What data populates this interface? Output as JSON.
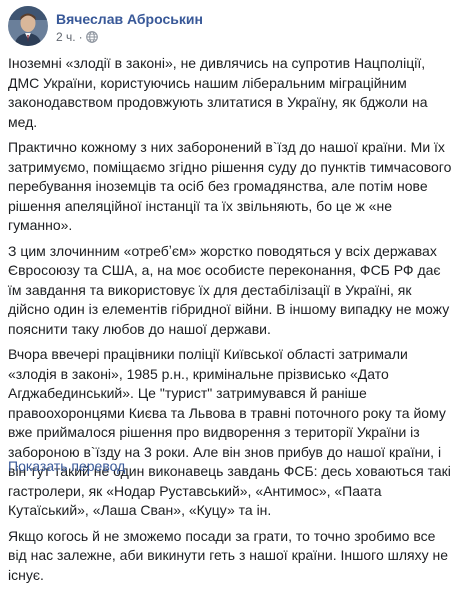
{
  "post": {
    "author": "Вячеслав Аброськин",
    "time": "2 ч.",
    "separator": "·",
    "privacy_icon": "globe-icon",
    "paragraphs": [
      "Іноземні «злодії в законі», не дивлячись на супротив Нацполіції, ДМС України, користуючись нашим ліберальним міграційним законодавством продовжують злитатися в Україну, як бджоли на мед.",
      "Практично кожному з них заборонений в`їзд до нашої країни. Ми їх затримуємо, поміщаємо згідно рішення суду до пунктів тимчасового перебування іноземців та осіб без громадянства, але потім нове рішення апеляційної інстанції та їх звільняють, бо це ж «не гуманно».",
      "З цим злочинним «отребʼєм» жорстко поводяться у всіх державах Євросоюзу та США, а, на моє особисте переконання, ФСБ РФ дає їм завдання та використовує їх для дестабілізації в Україні, як дійсно один із елементів гібридної війни. В іншому випадку не можу пояснити таку любов до нашої держави.",
      "Вчора ввечері працівники поліції Київської області затримали «злодія в законі», 1985 р.н., кримінальне прізвисько «Дато Агджабединський». Це \"турист\" затримувався й раніше правоохоронцями Києва та Львова в травні поточного року та йому вже приймалося рішення про видворення з території України із забороною в`їзду на 3 роки. Але він знов прибув до нашої країни, і він тут такий не один виконавець завдань ФСБ: десь ховаються такі гастролери, як «Нодар Руставський», «Антимос», «Паата Кутаїський», «Лаша Сван», «Куцу» та ін.",
      "Якщо когось й не зможемо посади за грати, то точно зробимо все від нас залежне, аби викинути геть з нашої країни. Іншого шляху не існує."
    ],
    "translate_label": "Показать перевод"
  }
}
